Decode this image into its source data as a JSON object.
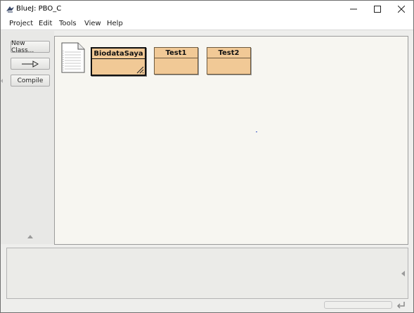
{
  "window": {
    "title": "BlueJ:  PBO_C",
    "icons": {
      "app": "bluej-bird-icon",
      "minimize": "minimize-icon",
      "maximize": "maximize-icon",
      "close": "close-icon"
    }
  },
  "menu": {
    "items": [
      "Project",
      "Edit",
      "Tools",
      "View",
      "Help"
    ]
  },
  "toolbar": {
    "new_class_label": "New Class...",
    "arrow_icon": "uses-arrow-icon",
    "compile_label": "Compile"
  },
  "diagram": {
    "readme_icon": "readme-document-icon",
    "classes": [
      {
        "name": "BiodataSaya",
        "selected": true
      },
      {
        "name": "Test1",
        "selected": false
      },
      {
        "name": "Test2",
        "selected": false
      }
    ],
    "class_color": "#f1c996",
    "background_color": "#f7f6f1"
  },
  "statusbar": {
    "icon": "return-arrow-icon"
  }
}
